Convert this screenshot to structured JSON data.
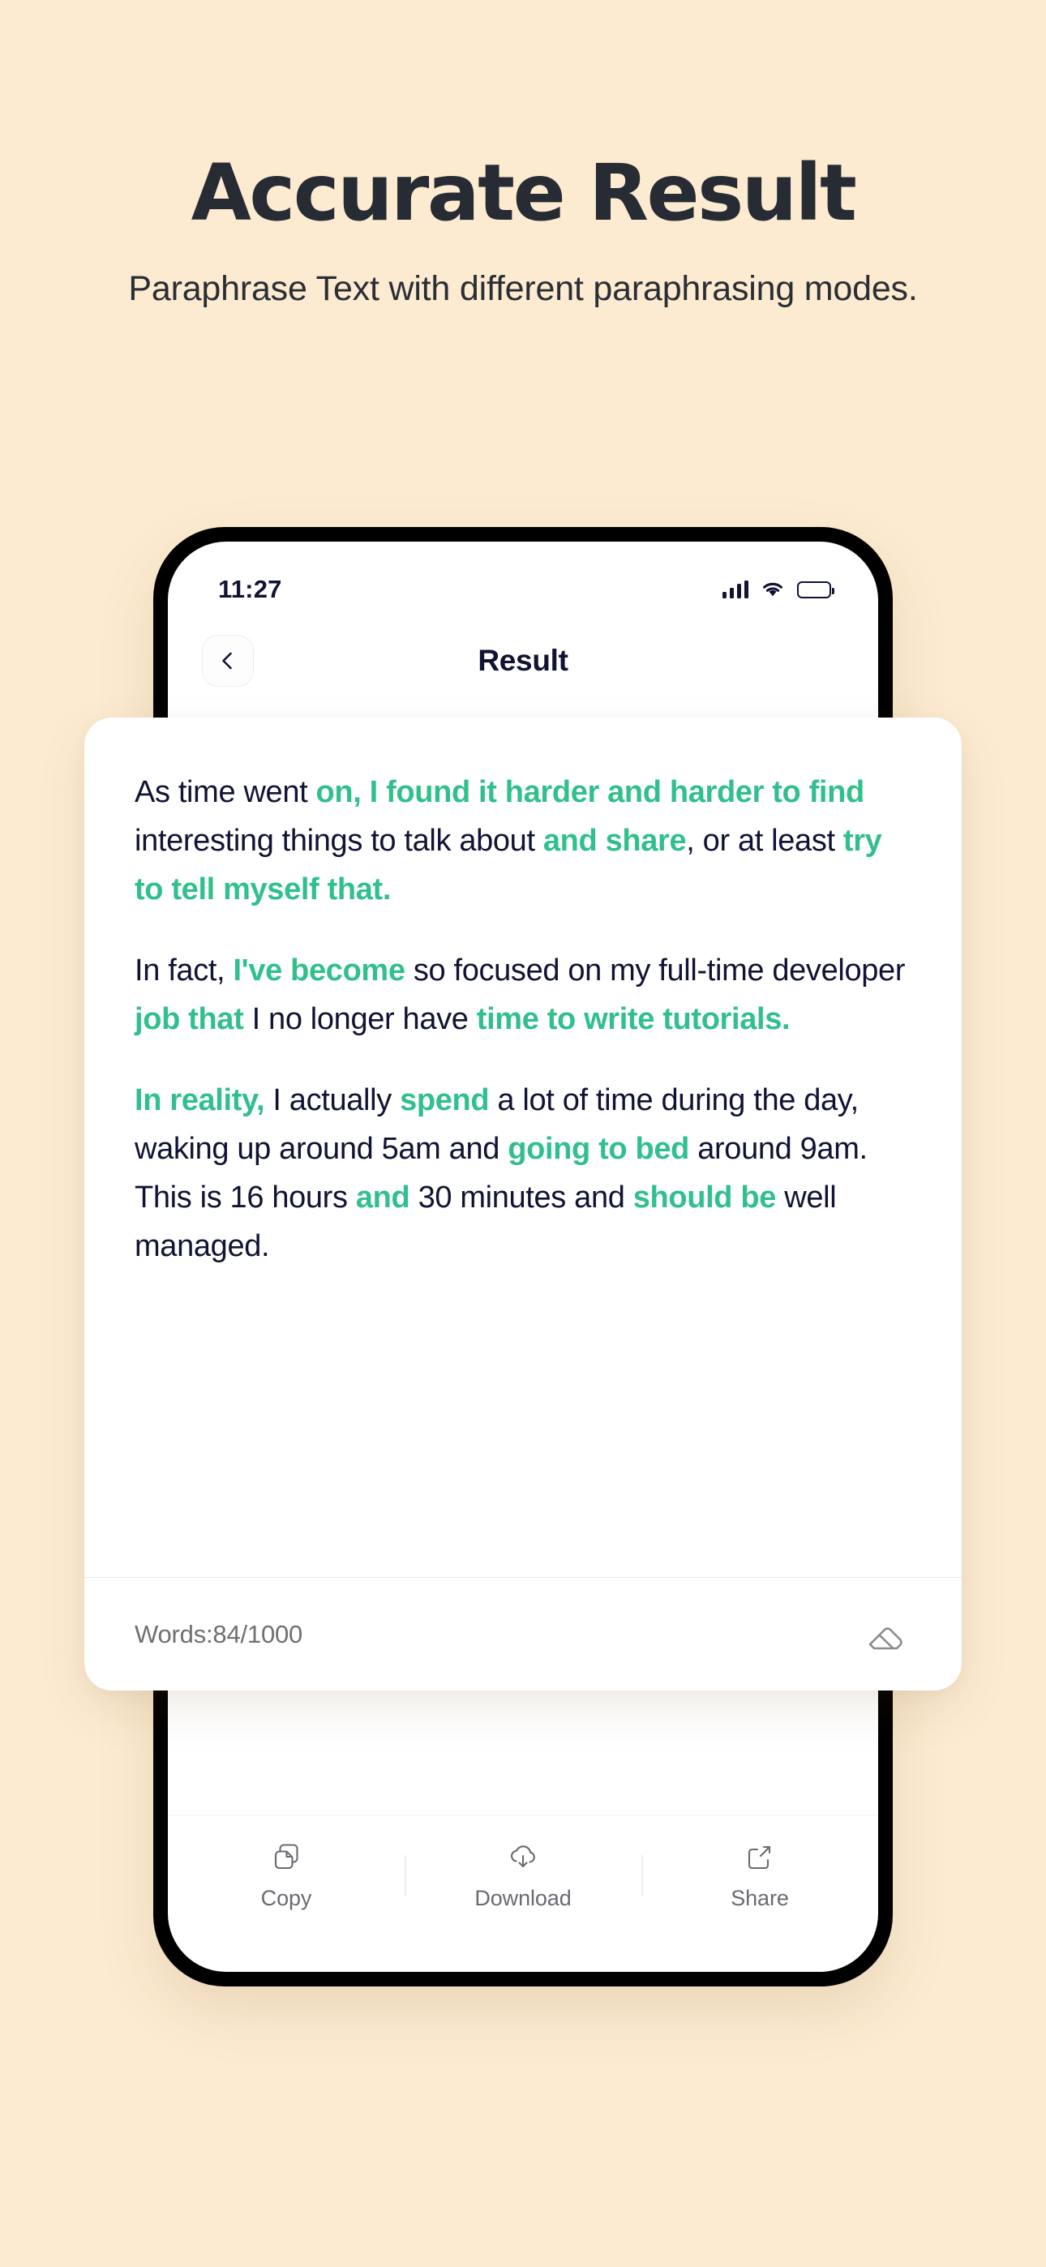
{
  "promo": {
    "title": "Accurate Result",
    "subtitle": "Paraphrase Text with different paraphrasing modes.",
    "background_color": "#FCEBD1",
    "title_color": "#272B33"
  },
  "phone": {
    "statusbar": {
      "time": "11:27",
      "signal_icon": "cellular-signal-icon",
      "wifi_icon": "wifi-icon",
      "battery_icon": "battery-full-icon"
    },
    "appbar": {
      "back_icon": "chevron-left-icon",
      "title": "Result"
    },
    "actionbar": {
      "items": [
        {
          "label": "Copy",
          "icon": "copy-icon"
        },
        {
          "label": "Download",
          "icon": "cloud-download-icon"
        },
        {
          "label": "Share",
          "icon": "share-icon"
        }
      ]
    }
  },
  "result_card": {
    "accent_color": "#31C08C",
    "text_color": "#101334",
    "paragraphs": [
      {
        "id": "p1",
        "runs": [
          {
            "text": "As time went ",
            "highlight": false
          },
          {
            "text": "on, I found it harder and harder to find",
            "highlight": true
          },
          {
            "text": " interesting things to talk about ",
            "highlight": false
          },
          {
            "text": "and share",
            "highlight": true
          },
          {
            "text": ", or at least ",
            "highlight": false
          },
          {
            "text": "try to tell myself that.",
            "highlight": true
          }
        ]
      },
      {
        "id": "p2",
        "runs": [
          {
            "text": "In fact, ",
            "highlight": false
          },
          {
            "text": "I've become",
            "highlight": true
          },
          {
            "text": " so focused on my full-time developer ",
            "highlight": false
          },
          {
            "text": "job that",
            "highlight": true
          },
          {
            "text": " I no longer have ",
            "highlight": false
          },
          {
            "text": "time to write tutorials.",
            "highlight": true
          }
        ]
      },
      {
        "id": "p3",
        "runs": [
          {
            "text": "In reality,",
            "highlight": true
          },
          {
            "text": " I actually ",
            "highlight": false
          },
          {
            "text": "spend",
            "highlight": true
          },
          {
            "text": " a lot of time during the day, waking up around 5am and ",
            "highlight": false
          },
          {
            "text": "going to bed",
            "highlight": true
          },
          {
            "text": " around 9am.",
            "highlight": false
          },
          {
            "text": "\nThis is 16 hours ",
            "highlight": false
          },
          {
            "text": "and",
            "highlight": true
          },
          {
            "text": " 30 minutes and ",
            "highlight": false
          },
          {
            "text": "should be",
            "highlight": true
          },
          {
            "text": " well managed.",
            "highlight": false
          }
        ]
      }
    ],
    "footer": {
      "words_label": "Words:84/1000",
      "eraser_icon": "eraser-icon"
    }
  }
}
